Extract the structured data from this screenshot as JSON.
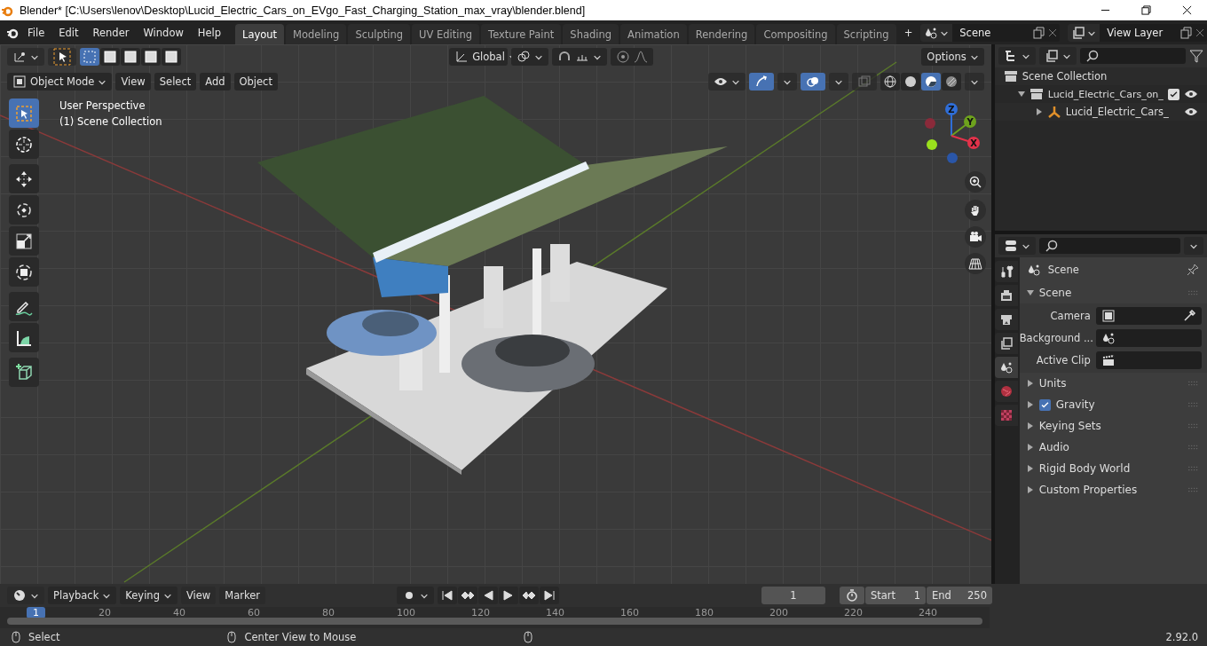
{
  "window": {
    "title": "Blender* [C:\\Users\\lenov\\Desktop\\Lucid_Electric_Cars_on_EVgo_Fast_Charging_Station_max_vray\\blender.blend]"
  },
  "menu": [
    "File",
    "Edit",
    "Render",
    "Window",
    "Help"
  ],
  "workspaces": [
    {
      "label": "Layout",
      "selected": true
    },
    {
      "label": "Modeling",
      "selected": false
    },
    {
      "label": "Sculpting",
      "selected": false
    },
    {
      "label": "UV Editing",
      "selected": false
    },
    {
      "label": "Texture Paint",
      "selected": false
    },
    {
      "label": "Shading",
      "selected": false
    },
    {
      "label": "Animation",
      "selected": false
    },
    {
      "label": "Rendering",
      "selected": false
    },
    {
      "label": "Compositing",
      "selected": false
    },
    {
      "label": "Scripting",
      "selected": false
    }
  ],
  "add_workspace": "+",
  "scene_selector": {
    "value": "Scene"
  },
  "view_layer_selector": {
    "value": "View Layer"
  },
  "viewport": {
    "orientation": "Global",
    "options": "Options",
    "mode": "Object Mode",
    "menus": [
      "View",
      "Select",
      "Add",
      "Object"
    ],
    "select_modes": [
      {
        "selected": true
      },
      {
        "selected": false
      },
      {
        "selected": false
      },
      {
        "selected": false
      },
      {
        "selected": false
      }
    ],
    "toggles": [
      {
        "kind": "gizmo",
        "on": true
      },
      {
        "kind": "overlay",
        "on": true
      }
    ],
    "shading": [
      {
        "kind": "wireframe",
        "selected": false
      },
      {
        "kind": "solid",
        "selected": false
      },
      {
        "kind": "material",
        "selected": true
      },
      {
        "kind": "rendered",
        "selected": false
      }
    ],
    "overlay_text": [
      "User Perspective",
      "(1) Scene Collection"
    ],
    "tool_groups": [
      [
        {
          "kind": "select",
          "selected": true
        },
        {
          "kind": "cursor",
          "selected": false
        }
      ],
      [
        {
          "kind": "move",
          "selected": false
        },
        {
          "kind": "rotate",
          "selected": false
        },
        {
          "kind": "scale",
          "selected": false
        },
        {
          "kind": "transform",
          "selected": false
        }
      ],
      [
        {
          "kind": "annotate",
          "selected": false
        },
        {
          "kind": "measure",
          "selected": false
        }
      ],
      [
        {
          "kind": "add-cube",
          "selected": false
        }
      ]
    ],
    "gizmo_axes": [
      {
        "label": "Z",
        "color": "#2f6ed8"
      },
      {
        "label": "Y",
        "color": "#6ea21d"
      },
      {
        "label": "X",
        "color": "#e3324a"
      }
    ]
  },
  "outliner": {
    "root": "Scene Collection",
    "children": [
      {
        "label": "Lucid_Electric_Cars_on_",
        "expanded": true,
        "checked": true,
        "children": [
          {
            "label": "Lucid_Electric_Cars_",
            "expanded": false
          }
        ]
      }
    ]
  },
  "properties": {
    "tabs": [
      {
        "kind": "tool",
        "selected": false
      },
      {
        "kind": "render",
        "selected": false
      },
      {
        "kind": "output",
        "selected": false
      },
      {
        "kind": "view-layer",
        "selected": false
      },
      {
        "kind": "scene",
        "selected": true
      },
      {
        "kind": "world",
        "selected": false
      },
      {
        "kind": "texture",
        "selected": false
      }
    ],
    "context": "Scene",
    "panels": [
      {
        "label": "Scene",
        "kind": "plain",
        "expanded": true,
        "fields": [
          {
            "label": "Camera",
            "kind": "camera"
          },
          {
            "label": "Background ...",
            "kind": "scene"
          },
          {
            "label": "Active Clip",
            "kind": "clip"
          }
        ]
      },
      {
        "label": "Units",
        "kind": "plain",
        "expanded": false
      },
      {
        "label": "Gravity",
        "kind": "checkbox",
        "checked": true,
        "expanded": false
      },
      {
        "label": "Keying Sets",
        "kind": "plain",
        "expanded": false
      },
      {
        "label": "Audio",
        "kind": "plain",
        "expanded": false
      },
      {
        "label": "Rigid Body World",
        "kind": "plain",
        "expanded": false
      },
      {
        "label": "Custom Properties",
        "kind": "plain",
        "expanded": false
      }
    ]
  },
  "timeline": {
    "menus": [
      {
        "label": "Playback",
        "kind": "dropdown"
      },
      {
        "label": "Keying",
        "kind": "dropdown"
      },
      {
        "label": "View",
        "kind": "plain"
      },
      {
        "label": "Marker",
        "kind": "plain"
      }
    ],
    "current_frame": "1",
    "start_label": "Start",
    "start": "1",
    "end_label": "End",
    "end": "250",
    "playhead": "1",
    "ruler": [
      "20",
      "40",
      "60",
      "80",
      "100",
      "120",
      "140",
      "160",
      "180",
      "200",
      "220",
      "240"
    ]
  },
  "status_bar": {
    "hints": [
      "Select",
      "Center View to Mouse"
    ],
    "version": "2.92.0"
  }
}
